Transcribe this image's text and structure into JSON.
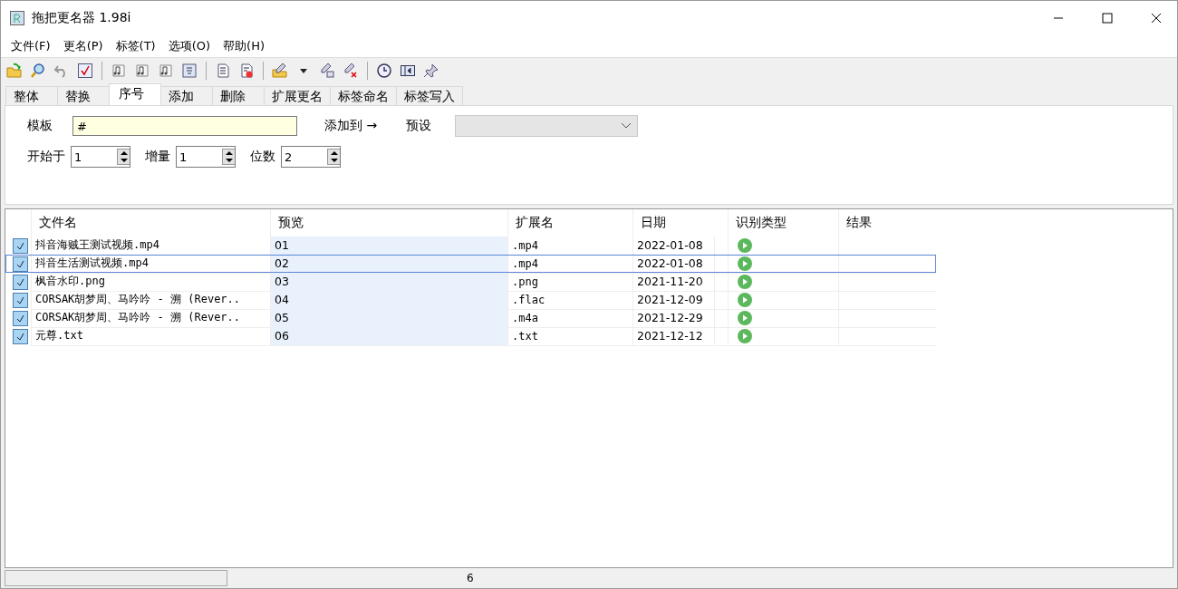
{
  "window": {
    "title": "拖把更名器 1.98i"
  },
  "menu": [
    "文件(F)",
    "更名(P)",
    "标签(T)",
    "选项(O)",
    "帮助(H)"
  ],
  "tabs": [
    {
      "label": "整体",
      "selected": false
    },
    {
      "label": "替换",
      "selected": false
    },
    {
      "label": "序号",
      "selected": true
    },
    {
      "label": "添加",
      "selected": false
    },
    {
      "label": "删除",
      "selected": false
    },
    {
      "label": "扩展更名",
      "selected": false
    },
    {
      "label": "标签命名",
      "selected": false
    },
    {
      "label": "标签写入",
      "selected": false
    }
  ],
  "panel": {
    "template_label": "模板",
    "template_value": "#",
    "add_to": "添加到 →",
    "preset_label": "预设",
    "spinners": [
      {
        "label": "开始于",
        "value": "1"
      },
      {
        "label": "增量",
        "value": "1"
      },
      {
        "label": "位数",
        "value": "2"
      }
    ]
  },
  "table": {
    "columns": [
      "文件名",
      "预览",
      "扩展名",
      "日期",
      "识别类型",
      "结果"
    ],
    "rows": [
      {
        "checked": true,
        "selected": false,
        "name": "抖音海贼王测试视频.mp4",
        "preview": "01",
        "ext": ".mp4",
        "date": "2022-01-08"
      },
      {
        "checked": true,
        "selected": true,
        "name": "抖音生活测试视频.mp4",
        "preview": "02",
        "ext": ".mp4",
        "date": "2022-01-08"
      },
      {
        "checked": true,
        "selected": false,
        "name": "枫音水印.png",
        "preview": "03",
        "ext": ".png",
        "date": "2021-11-20"
      },
      {
        "checked": true,
        "selected": false,
        "name": "CORSAK胡梦周、马吟吟 - 溯 (Rever..",
        "preview": "04",
        "ext": ".flac",
        "date": "2021-12-09"
      },
      {
        "checked": true,
        "selected": false,
        "name": "CORSAK胡梦周、马吟吟 - 溯 (Rever..",
        "preview": "05",
        "ext": ".m4a",
        "date": "2021-12-29"
      },
      {
        "checked": true,
        "selected": false,
        "name": "元尊.txt",
        "preview": "06",
        "ext": ".txt",
        "date": "2021-12-12"
      }
    ]
  },
  "status_bar": {
    "count": "6",
    "level": 0
  }
}
